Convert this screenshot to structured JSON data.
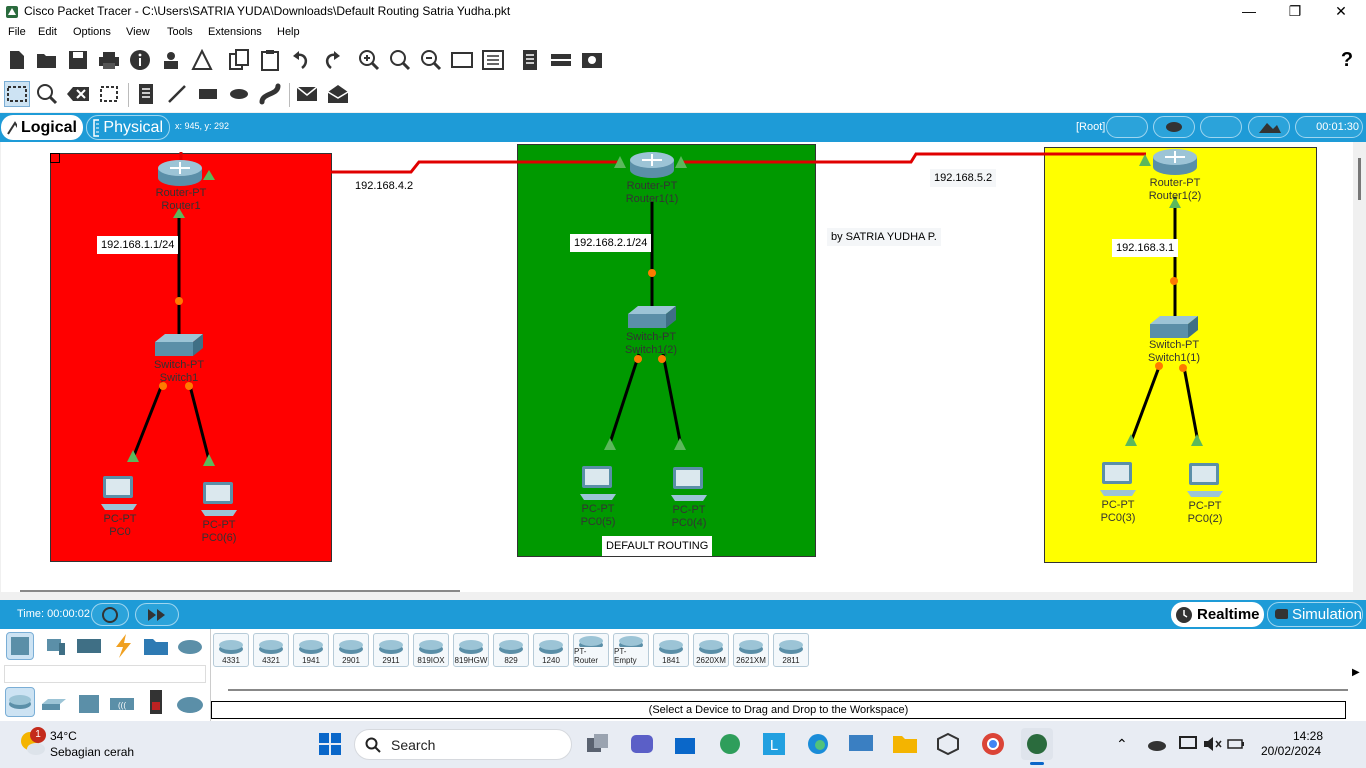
{
  "window": {
    "title": "Cisco Packet Tracer - C:\\Users\\SATRIA YUDA\\Downloads\\Default Routing Satria Yudha.pkt",
    "icon": "packet-tracer-icon"
  },
  "menu": [
    "File",
    "Edit",
    "Options",
    "View",
    "Tools",
    "Extensions",
    "Help"
  ],
  "modebar": {
    "logical": "Logical",
    "physical": "Physical",
    "coords": "x: 945, y: 292",
    "root": "[Root]",
    "clock": "00:01:30"
  },
  "networks": {
    "left": {
      "router_model": "Router-PT",
      "router_name": "Router1",
      "ip": "192.168.1.1/24",
      "switch_model": "Switch-PT",
      "switch_name": "Switch1",
      "pc_a_model": "PC-PT",
      "pc_a_name": "PC0",
      "pc_b_model": "PC-PT",
      "pc_b_name": "PC0(6)",
      "color": "#ff0000"
    },
    "middle": {
      "router_model": "Router-PT",
      "router_name": "Router1(1)",
      "ip": "192.168.2.1/24",
      "switch_model": "Switch-PT",
      "switch_name": "Switch1(2)",
      "pc_a_model": "PC-PT",
      "pc_a_name": "PC0(5)",
      "pc_b_model": "PC-PT",
      "pc_b_name": "PC0(4)",
      "note": "DEFAULT ROUTING",
      "color": "#009900"
    },
    "right": {
      "router_model": "Router-PT",
      "router_name": "Router1(2)",
      "ip": "192.168.3.1",
      "switch_model": "Switch-PT",
      "switch_name": "Switch1(1)",
      "pc_a_model": "PC-PT",
      "pc_a_name": "PC0(3)",
      "pc_b_model": "PC-PT",
      "pc_b_name": "PC0(2)",
      "color": "#ffff00"
    }
  },
  "links": {
    "left_middle": "192.168.4.2",
    "middle_right": "192.168.5.2"
  },
  "author": "by SATRIA YUDHA P.",
  "timebar": {
    "time": "Time: 00:00:02",
    "realtime": "Realtime",
    "simulation": "Simulation"
  },
  "devices": [
    "4331",
    "4321",
    "1941",
    "2901",
    "2911",
    "819IOX",
    "819HGW",
    "829",
    "1240",
    "PT-Router",
    "PT-Empty",
    "1841",
    "2620XM",
    "2621XM",
    "2811"
  ],
  "status_hint": "(Select a Device to Drag and Drop to the Workspace)",
  "taskbar": {
    "weather_temp": "34°C",
    "weather_desc": "Sebagian cerah",
    "weather_badge": "1",
    "search": "Search",
    "time": "14:28",
    "date": "20/02/2024"
  }
}
